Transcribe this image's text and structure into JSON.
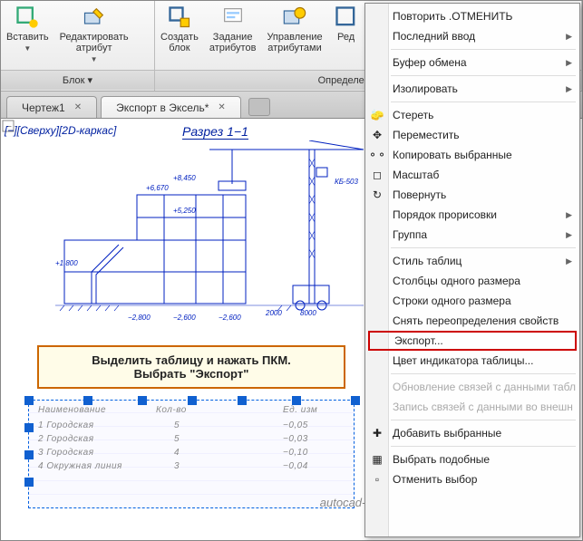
{
  "ribbon": {
    "groups": [
      {
        "title": "Блок ▾",
        "buttons": [
          {
            "label": "Вставить",
            "icon": "insert"
          },
          {
            "label": "Редактировать\nатрибут",
            "icon": "edit-attr"
          }
        ]
      },
      {
        "title": "Определение блока ▾",
        "buttons": [
          {
            "label": "Создать\nблок",
            "icon": "create-block"
          },
          {
            "label": "Задание\nатрибутов",
            "icon": "define-attr"
          },
          {
            "label": "Управление\nатрибутами",
            "icon": "manage-attr"
          },
          {
            "label": "Ред",
            "icon": "block-edit"
          }
        ]
      }
    ]
  },
  "tabs": {
    "items": [
      {
        "label": "Чертеж1",
        "active": false
      },
      {
        "label": "Экспорт в Эксель*",
        "active": true
      }
    ]
  },
  "view_label": "[−][Сверху][2D-каркас]",
  "drawing_title": "Разрез 1−1",
  "crane_label": "КБ-503",
  "elevations": [
    "+6,670",
    "+8,450",
    "+5,250",
    "+1,800",
    "−2,800",
    "−2,600",
    "−2,600"
  ],
  "dims": [
    "2000",
    "8000"
  ],
  "callout": {
    "line1": "Выделить таблицу и нажать ПКМ.",
    "line2": "Выбрать \"Экспорт\""
  },
  "footer_text": "autocad-specialist.ru",
  "context_menu": {
    "items": [
      {
        "label": "Повторить .ОТМЕНИТЬ",
        "type": "item"
      },
      {
        "label": "Последний ввод",
        "type": "item",
        "submenu": true
      },
      {
        "type": "sep"
      },
      {
        "label": "Буфер обмена",
        "type": "item",
        "submenu": true
      },
      {
        "type": "sep"
      },
      {
        "label": "Изолировать",
        "type": "item",
        "submenu": true
      },
      {
        "type": "sep"
      },
      {
        "label": "Стереть",
        "icon": "erase-icon",
        "type": "item"
      },
      {
        "label": "Переместить",
        "icon": "move-icon",
        "type": "item"
      },
      {
        "label": "Копировать выбранные",
        "icon": "copy-icon",
        "type": "item"
      },
      {
        "label": "Масштаб",
        "icon": "scale-icon",
        "type": "item"
      },
      {
        "label": "Повернуть",
        "icon": "rotate-icon",
        "type": "item"
      },
      {
        "label": "Порядок прорисовки",
        "type": "item",
        "submenu": true
      },
      {
        "label": "Группа",
        "type": "item",
        "submenu": true
      },
      {
        "type": "sep"
      },
      {
        "label": "Стиль таблиц",
        "type": "item",
        "submenu": true
      },
      {
        "label": "Столбцы одного размера",
        "type": "item"
      },
      {
        "label": "Строки одного размера",
        "type": "item"
      },
      {
        "label": "Снять переопределения свойств",
        "type": "item"
      },
      {
        "label": "Экспорт...",
        "type": "item",
        "highlight": true
      },
      {
        "label": "Цвет индикатора таблицы...",
        "type": "item"
      },
      {
        "type": "sep"
      },
      {
        "label": "Обновление связей с данными табл",
        "type": "item",
        "disabled": true
      },
      {
        "label": "Запись связей с данными во внешн",
        "type": "item",
        "disabled": true
      },
      {
        "type": "sep"
      },
      {
        "label": "Добавить выбранные",
        "icon": "add-sel-icon",
        "type": "item"
      },
      {
        "type": "sep"
      },
      {
        "label": "Выбрать подобные",
        "icon": "select-similar-icon",
        "type": "item"
      },
      {
        "label": "Отменить выбор",
        "icon": "deselect-icon",
        "type": "item"
      }
    ]
  }
}
